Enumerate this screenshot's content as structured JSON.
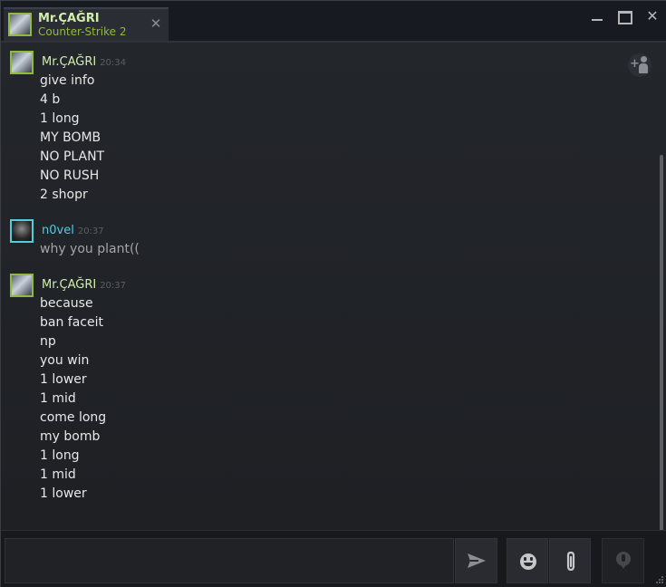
{
  "window": {
    "tab": {
      "name": "Mr.ÇAĞRI",
      "game": "Counter-Strike 2",
      "close_glyph": "✕"
    },
    "controls": {
      "close_glyph": "✕"
    }
  },
  "messages": [
    {
      "sender": "Mr.ÇAĞRI",
      "time": "20:34",
      "lines": [
        "give info",
        "4 b",
        "1 long",
        "MY BOMB",
        "NO PLANT",
        "NO RUSH",
        "2 shopr"
      ]
    },
    {
      "sender": "n0vel",
      "time": "20:37",
      "lines": [
        "why you plant(("
      ]
    },
    {
      "sender": "Mr.ÇAĞRI",
      "time": "20:37",
      "lines": [
        "because",
        "ban faceit",
        "np",
        "you win",
        "1 lower",
        "1 mid",
        "come long",
        "my bomb",
        "1 long",
        "1 mid",
        "1 lower"
      ]
    }
  ],
  "composer": {
    "message_value": ""
  },
  "colors": {
    "in_game": "#90ba3c",
    "in_game_name": "#d2efa9",
    "online": "#57cbde",
    "background": "#1e2024"
  },
  "icons": [
    "user-avatar",
    "close-icon",
    "minimize-icon",
    "maximize-icon",
    "add-friend-icon",
    "send-icon",
    "emoji-icon",
    "attachment-icon",
    "voice-chat-icon",
    "resize-grip-icon"
  ]
}
